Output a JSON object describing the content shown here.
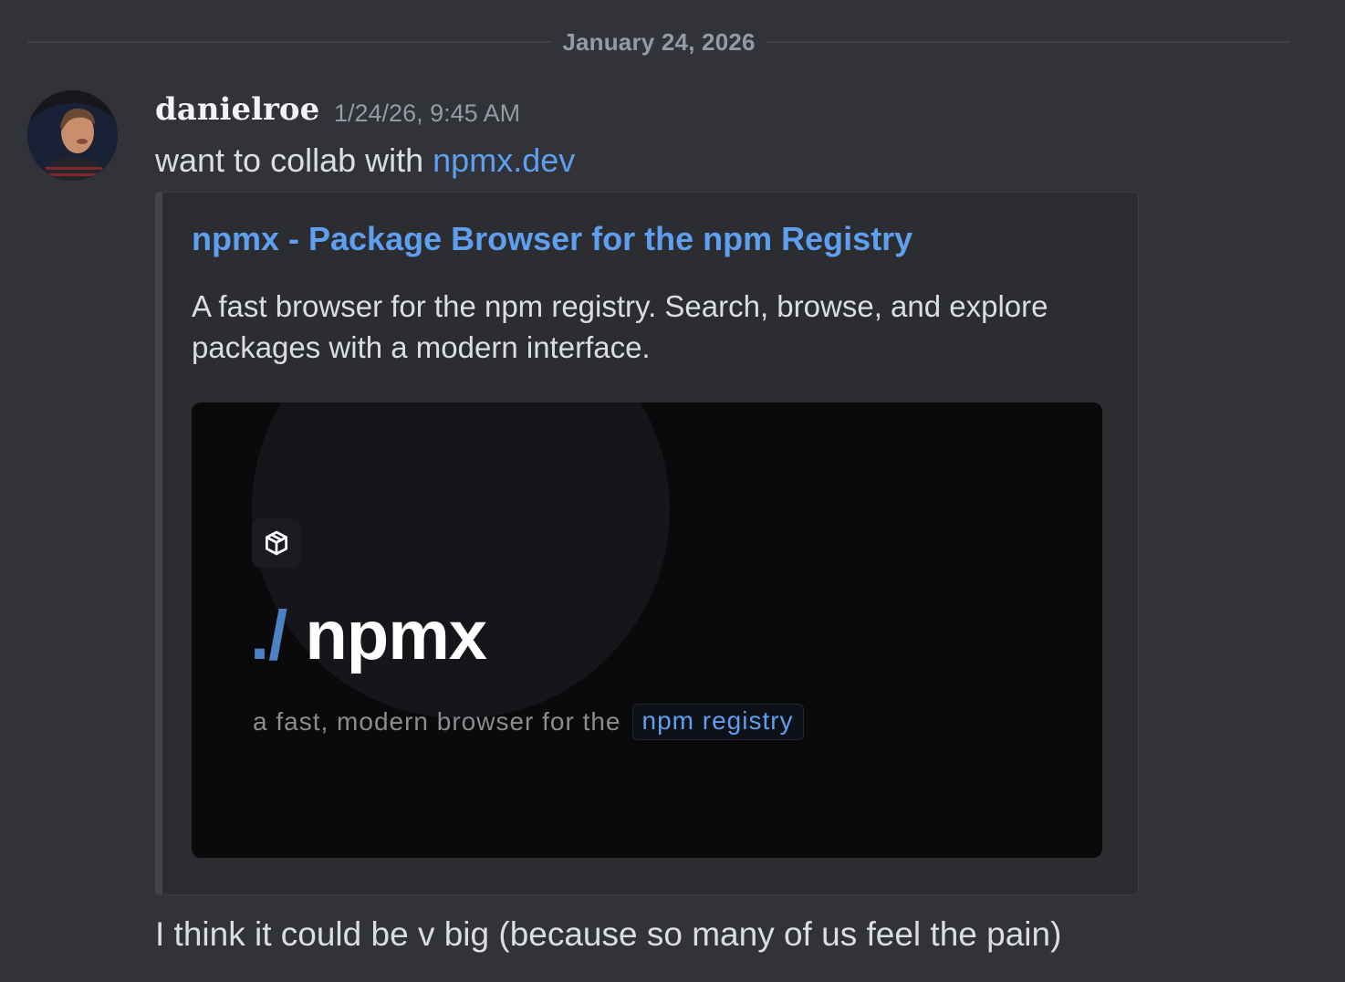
{
  "date_divider": "January 24, 2026",
  "message": {
    "username": "danielroe",
    "timestamp": "1/24/26, 9:45 AM",
    "text_prefix": "want to collab with ",
    "link_text": "npmx.dev",
    "followup": "I think it could be v big (because so many of us feel the pain)"
  },
  "embed": {
    "title": "npmx - Package Browser for the npm Registry",
    "description": "A fast browser for the npm registry. Search, browse, and explore packages with a modern interface.",
    "image": {
      "logo_prefix": "./",
      "logo_name": "npmx",
      "tagline": "a fast, modern browser for the",
      "tagline_chip": "npm registry",
      "icon": "package-icon"
    }
  },
  "colors": {
    "background": "#313338",
    "link": "#5e9ff0",
    "embed_bg": "#2b2d31",
    "muted": "#949ba4"
  }
}
